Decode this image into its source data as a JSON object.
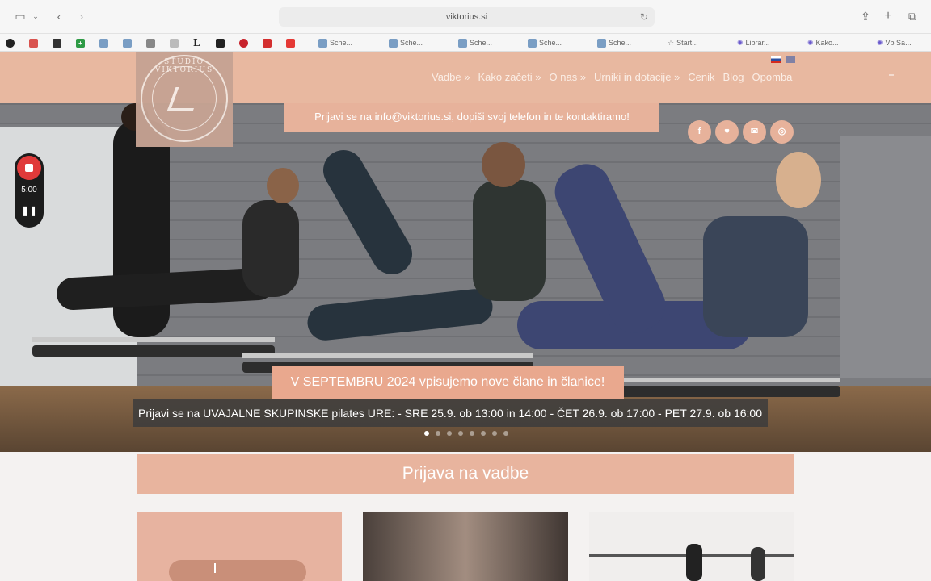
{
  "browser": {
    "url": "viktorius.si",
    "icons": {
      "sidebar": "sidebar-icon",
      "back": "chevron-left-icon",
      "forward": "chevron-right-icon",
      "reload": "reload-icon",
      "share": "share-icon",
      "new_tab": "plus-icon",
      "tabs": "tabs-icon"
    },
    "bookmarks": [
      {
        "label": "Sche...",
        "icon": "shield"
      },
      {
        "label": "Sche...",
        "icon": "shield"
      },
      {
        "label": "Sche...",
        "icon": "shield"
      },
      {
        "label": "Sche...",
        "icon": "shield"
      },
      {
        "label": "Sche...",
        "icon": "shield"
      },
      {
        "label": "Start...",
        "icon": "star"
      },
      {
        "label": "Librar...",
        "icon": "gear"
      },
      {
        "label": "Kako...",
        "icon": "gear"
      },
      {
        "label": "Vb Sa...",
        "icon": "gear"
      }
    ],
    "bookmark_glyphs": [
      "L"
    ]
  },
  "site": {
    "logo_text": "STUDIO VIKTORIUS",
    "nav": [
      "Vadbe »",
      "Kako začeti »",
      "O nas »",
      "Urniki in dotacije »",
      "Cenik",
      "Blog",
      "Opomba"
    ],
    "top_banner": "Prijavi se na info@viktorius.si, dopiši svoj telefon in te kontaktiramo!",
    "socials": [
      "f",
      "♥",
      "✉",
      "◎"
    ],
    "hero_cta": "V SEPTEMBRU 2024 vpisujemo nove člane in članice!",
    "hero_sub": "Prijavi se na UVAJALNE SKUPINSKE pilates URE: - SRE 25.9. ob 13:00 in 14:00 - ČET 26.9. ob 17:00 - PET 27.9. ob 16:00",
    "signup_title": "Prijava na vadbe",
    "slider_dots": 8,
    "slider_active": 0
  },
  "recorder": {
    "time": "5:00",
    "pause": "❚❚"
  },
  "colors": {
    "accent": "#e8b8a0",
    "cta": "#e9a88e",
    "record": "#e03a3a"
  }
}
